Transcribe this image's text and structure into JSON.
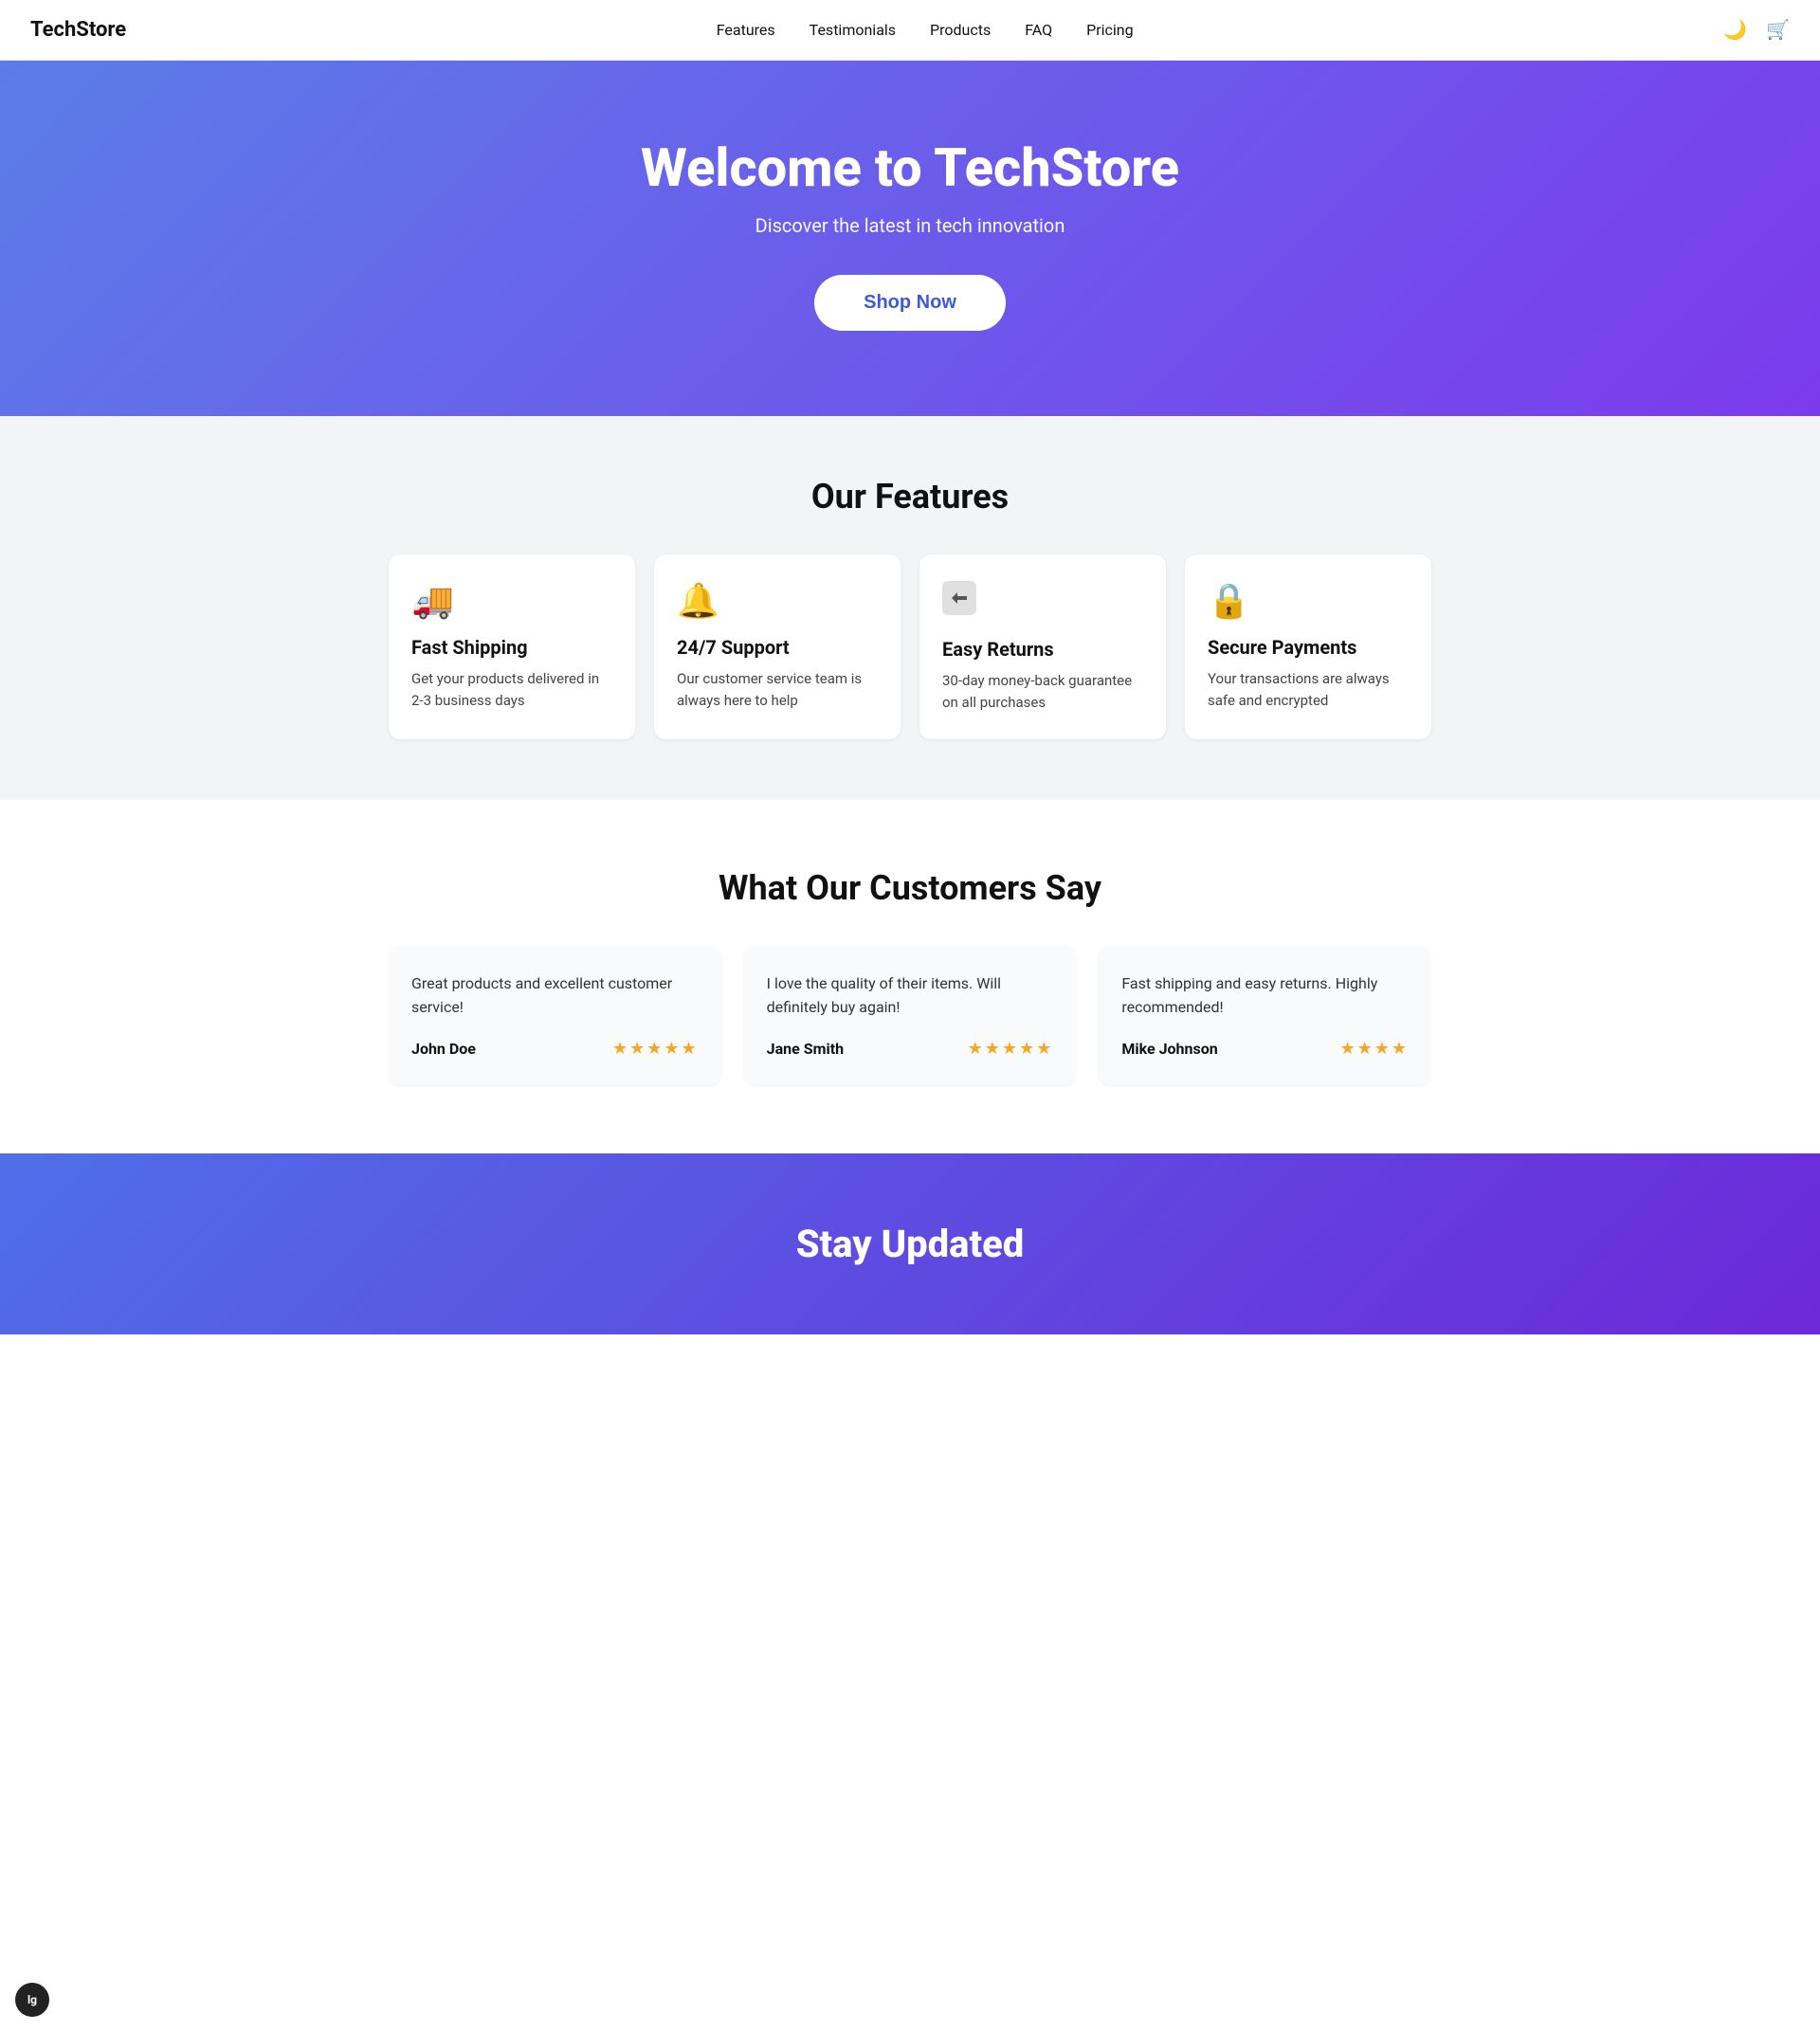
{
  "nav": {
    "logo": "TechStore",
    "links": [
      {
        "label": "Features",
        "id": "nav-features"
      },
      {
        "label": "Testimonials",
        "id": "nav-testimonials"
      },
      {
        "label": "Products",
        "id": "nav-products"
      },
      {
        "label": "FAQ",
        "id": "nav-faq"
      },
      {
        "label": "Pricing",
        "id": "nav-pricing"
      }
    ],
    "dark_mode_icon": "🌙",
    "cart_icon": "🛒"
  },
  "hero": {
    "title": "Welcome to TechStore",
    "subtitle": "Discover the latest in tech innovation",
    "cta_label": "Shop Now"
  },
  "features": {
    "section_title": "Our Features",
    "items": [
      {
        "icon": "🚚",
        "title": "Fast Shipping",
        "desc": "Get your products delivered in 2-3 business days"
      },
      {
        "icon": "🔔",
        "title": "24/7 Support",
        "desc": "Our customer service team is always here to help"
      },
      {
        "icon": "↩",
        "title": "Easy Returns",
        "desc": "30-day money-back guarantee on all purchases"
      },
      {
        "icon": "🔒",
        "title": "Secure Payments",
        "desc": "Your transactions are always safe and encrypted"
      }
    ]
  },
  "testimonials": {
    "section_title": "What Our Customers Say",
    "items": [
      {
        "text": "Great products and excellent customer service!",
        "name": "John Doe",
        "stars": "★★★★★",
        "rating": 5
      },
      {
        "text": "I love the quality of their items. Will definitely buy again!",
        "name": "Jane Smith",
        "stars": "★★★★★",
        "rating": 5
      },
      {
        "text": "Fast shipping and easy returns. Highly recommended!",
        "name": "Mike Johnson",
        "stars": "★★★★",
        "rating": 4
      }
    ]
  },
  "stay_updated": {
    "title": "Stay Updated"
  },
  "breakpoint": "lg"
}
